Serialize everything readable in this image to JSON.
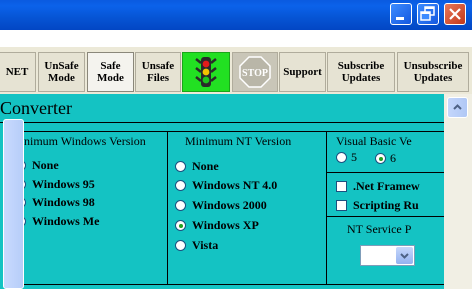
{
  "window": {
    "controls": [
      "minimize",
      "restore",
      "close"
    ]
  },
  "toolbar": {
    "buttons": [
      {
        "label": "NET",
        "name": "net"
      },
      {
        "label": "UnSafe\nMode",
        "name": "unsafe-mode"
      },
      {
        "label": "Safe\nMode",
        "name": "safe-mode",
        "pressed": true
      },
      {
        "label": "Unsafe\nFiles",
        "name": "unsafe-files"
      },
      {
        "icon": "traffic-light-icon",
        "name": "traffic-light"
      },
      {
        "label": "STOP",
        "icon": "stop-sign-icon",
        "name": "stop"
      },
      {
        "label": "Support",
        "name": "support"
      },
      {
        "label": "Subscribe\nUpdates",
        "name": "subscribe-updates"
      },
      {
        "label": "Unsubscribe\nUpdates",
        "name": "unsubscribe-updates"
      }
    ]
  },
  "main": {
    "title": "Converter",
    "min_windows": {
      "heading": "Minimum Windows Version",
      "options": [
        "None",
        "Windows 95",
        "Windows 98",
        "Windows Me"
      ],
      "selected": "None"
    },
    "min_nt": {
      "heading": "Minimum NT Version",
      "options": [
        "None",
        "Windows NT 4.0",
        "Windows 2000",
        "Windows XP",
        "Vista"
      ],
      "selected": "Windows XP"
    },
    "vb": {
      "heading": "Visual Basic Ve",
      "options": [
        "5",
        "6"
      ],
      "selected": "6"
    },
    "checks": [
      ".Net Framew",
      "Scripting Ru"
    ],
    "nt_service": {
      "heading": "NT Service P",
      "value": ""
    }
  },
  "colors": {
    "background": "#14c3c3",
    "titlebar": "#0a5ae0",
    "toolbar": "#ece9d8",
    "green_button": "#22e022"
  }
}
